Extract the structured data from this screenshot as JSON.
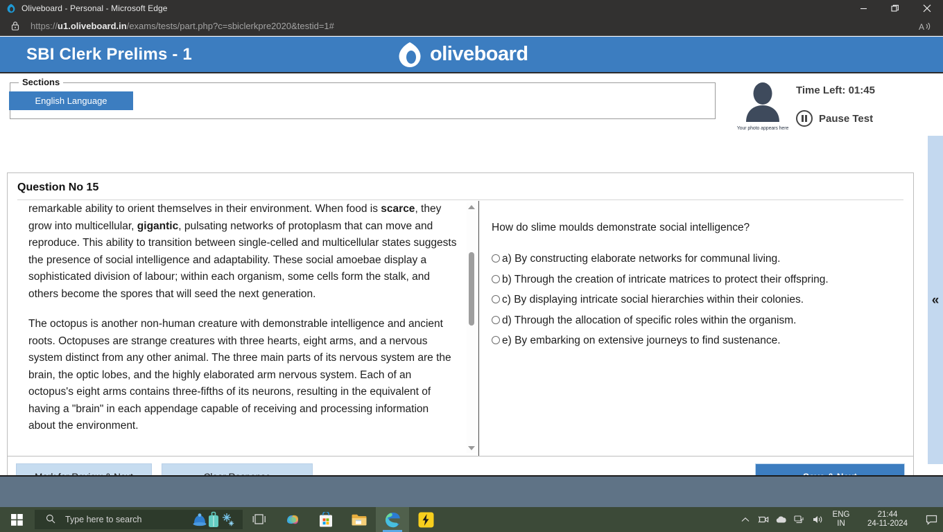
{
  "window": {
    "title": "Oliveboard - Personal - Microsoft Edge",
    "minimize_label": "—",
    "restore_label": "❐",
    "close_label": "✕",
    "url_scheme": "https://",
    "url_host": "u1.oliveboard.in",
    "url_path": "/exams/tests/part.php?c=sbiclerkpre2020&testid=1#",
    "read_aloud_label": "A"
  },
  "brand": {
    "exam_title": "SBI Clerk Prelims - 1",
    "logo_text": "oliveboard",
    "header_color": "#3c7dc0"
  },
  "sections": {
    "legend": "Sections",
    "tabs": [
      {
        "label": "English Language",
        "active": true
      }
    ]
  },
  "status": {
    "avatar_caption": "Your photo appears here",
    "time_left": "Time Left: 01:45",
    "pause_label": "Pause Test"
  },
  "question": {
    "number_label": "Question No 15",
    "passage_paragraphs": [
      "remarkable ability to orient themselves in their environment. When food is scarce, they grow into multicellular, gigantic, pulsating networks of protoplasm that can move and reproduce. This ability to transition between single-celled and multicellular states suggests the presence of social intelligence and adaptability. These social amoebae display a sophisticated division of labour; within each organism, some cells form the stalk, and others become the spores that will seed the next generation.",
      "The octopus is another non-human creature with demonstrable intelligence and ancient roots. Octopuses are strange creatures with three hearts, eight arms, and a nervous system distinct from any other animal. The three main parts of its nervous system are the brain, the optic lobes, and the highly elaborated arm nervous system. Each of an octopus's eight arms contains three-fifths of its neurons, resulting in the equivalent of having a \"brain\" in each appendage capable of receiving and processing information about the environment."
    ],
    "bold_terms": [
      "scarce",
      "gigantic"
    ],
    "prompt": "How do slime moulds demonstrate social intelligence?",
    "options": [
      {
        "id": "a",
        "text": "a) By constructing elaborate networks for communal living.",
        "selected": false
      },
      {
        "id": "b",
        "text": "b) Through the creation of intricate matrices to protect their offspring.",
        "selected": false
      },
      {
        "id": "c",
        "text": "c) By displaying intricate social hierarchies within their colonies.",
        "selected": false
      },
      {
        "id": "d",
        "text": "d) Through the allocation of specific roles within the organism.",
        "selected": false
      },
      {
        "id": "e",
        "text": "e) By embarking on extensive journeys to find sustenance.",
        "selected": false
      }
    ]
  },
  "actions": {
    "mark_review": "Mark for Review & Next",
    "clear_response": "Clear Response",
    "save_next": "Save & Next",
    "collapse_chevron": "«"
  },
  "taskbar": {
    "search_placeholder": "Type here to search",
    "language": "ENG",
    "region": "IN",
    "time": "21:44",
    "date": "24-11-2024"
  }
}
